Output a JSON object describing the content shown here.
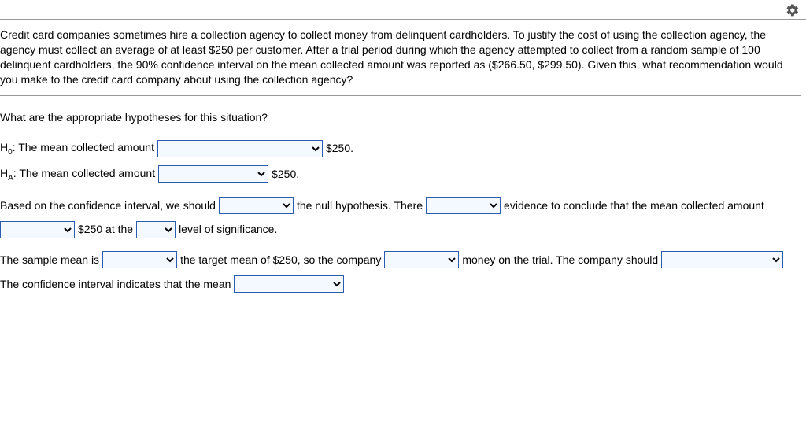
{
  "prompt_text": "Credit card companies sometimes hire a collection agency to collect money from delinquent cardholders. To justify the cost of using the collection agency, the agency must collect an average of at least $250 per customer. After a trial period during which the agency attempted to collect from a random sample of 100 delinquent cardholders, the 90% confidence interval on the mean collected amount was reported as ($266.50, $299.50). Given this, what recommendation would you make to the credit card company about using the collection agency?",
  "question": "What are the appropriate hypotheses for this situation?",
  "h0": {
    "prefix": "H",
    "sub": "0",
    "label": ": The mean collected amount",
    "tail": "$250."
  },
  "ha": {
    "prefix": "H",
    "sub": "A",
    "label": ": The mean collected amount",
    "tail": "$250."
  },
  "line3": {
    "t1": "Based on the confidence interval, we should",
    "t2": "the null hypothesis. There",
    "t3": "evidence to conclude that the mean collected amount"
  },
  "line4": {
    "t1": "$250 at the",
    "t2": "level of significance."
  },
  "line5": {
    "t1": "The sample mean is",
    "t2": "the target mean of $250, so the company",
    "t3": "money on the trial. The company should"
  },
  "line6": {
    "t1": "The confidence interval indicates that the mean"
  }
}
